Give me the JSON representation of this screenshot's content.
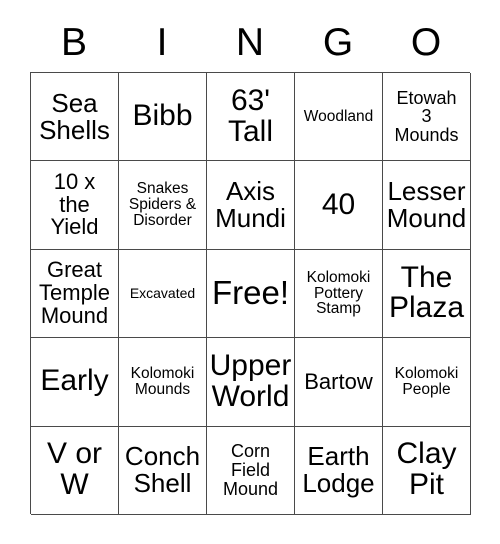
{
  "card": {
    "header_letters": [
      "B",
      "I",
      "N",
      "G",
      "O"
    ],
    "free_space_label": "Free!",
    "rows": [
      [
        {
          "text": "Sea\nShells",
          "size": "lg"
        },
        {
          "text": "Bibb",
          "size": "xl"
        },
        {
          "text": "63'\nTall",
          "size": "xl"
        },
        {
          "text": "Woodland",
          "size": "xs"
        },
        {
          "text": "Etowah\n3\nMounds",
          "size": "sm"
        }
      ],
      [
        {
          "text": "10 x\nthe\nYield",
          "size": "md"
        },
        {
          "text": "Snakes\nSpiders &\nDisorder",
          "size": "xs"
        },
        {
          "text": "Axis\nMundi",
          "size": "lg"
        },
        {
          "text": "40",
          "size": "xl"
        },
        {
          "text": "Lesser\nMound",
          "size": "lg"
        }
      ],
      [
        {
          "text": "Great\nTemple\nMound",
          "size": "md"
        },
        {
          "text": "Excavated",
          "size": "xxs"
        },
        {
          "text": "Free!",
          "size": "xxl"
        },
        {
          "text": "Kolomoki\nPottery\nStamp",
          "size": "xs"
        },
        {
          "text": "The\nPlaza",
          "size": "xl"
        }
      ],
      [
        {
          "text": "Early",
          "size": "xl"
        },
        {
          "text": "Kolomoki\nMounds",
          "size": "xs"
        },
        {
          "text": "Upper\nWorld",
          "size": "xl"
        },
        {
          "text": "Bartow",
          "size": "md"
        },
        {
          "text": "Kolomoki\nPeople",
          "size": "xs"
        }
      ],
      [
        {
          "text": "V or\nW",
          "size": "xl"
        },
        {
          "text": "Conch\nShell",
          "size": "lg"
        },
        {
          "text": "Corn\nField\nMound",
          "size": "sm"
        },
        {
          "text": "Earth\nLodge",
          "size": "lg"
        },
        {
          "text": "Clay\nPit",
          "size": "xl"
        }
      ]
    ]
  },
  "colors": {
    "background": "#ffffff",
    "text": "#000000",
    "grid_line": "#4a4a4a"
  }
}
